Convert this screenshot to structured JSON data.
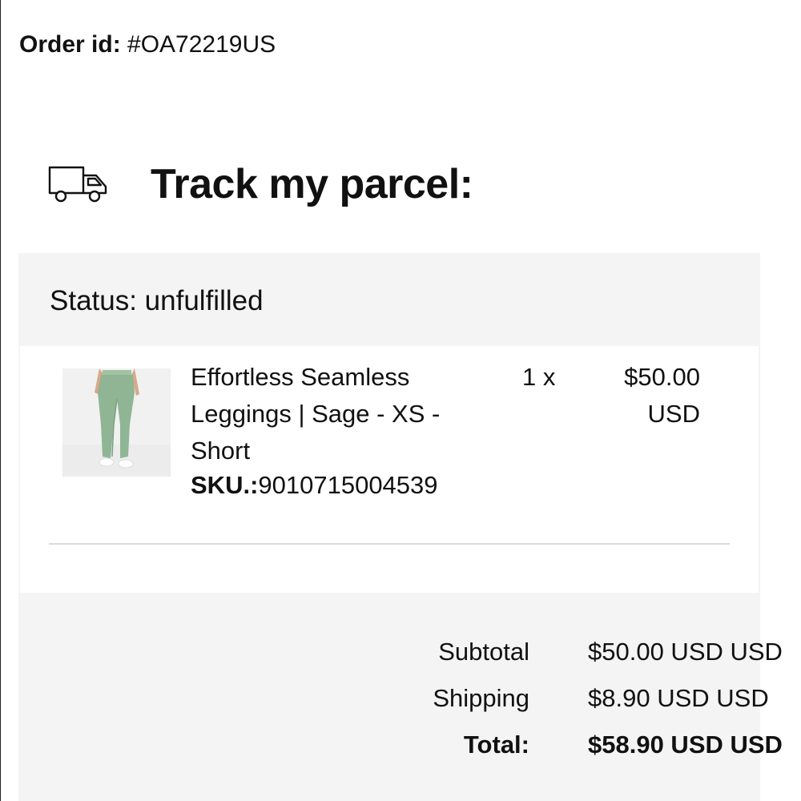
{
  "order": {
    "id_label": "Order id:",
    "id_value": "#OA72219US"
  },
  "track": {
    "icon": "truck-icon",
    "title": "Track my parcel:"
  },
  "status": {
    "text": "Status: unfulfilled"
  },
  "item": {
    "image_icon": "product-image",
    "name": "Effortless Seamless Leggings | Sage - XS - Short",
    "sku_label": "SKU.:",
    "sku_value": "9010715004539",
    "quantity": "1 x",
    "price": "$50.00 USD"
  },
  "totals": {
    "subtotal_label": "Subtotal",
    "subtotal_value": "$50.00 USD USD",
    "shipping_label": "Shipping",
    "shipping_value": "$8.90 USD USD",
    "total_label": "Total:",
    "total_value": "$58.90 USD USD"
  },
  "colors": {
    "panel_bg": "#f4f4f4",
    "card_bg": "#ffffff",
    "product_green": "#8fb595"
  }
}
